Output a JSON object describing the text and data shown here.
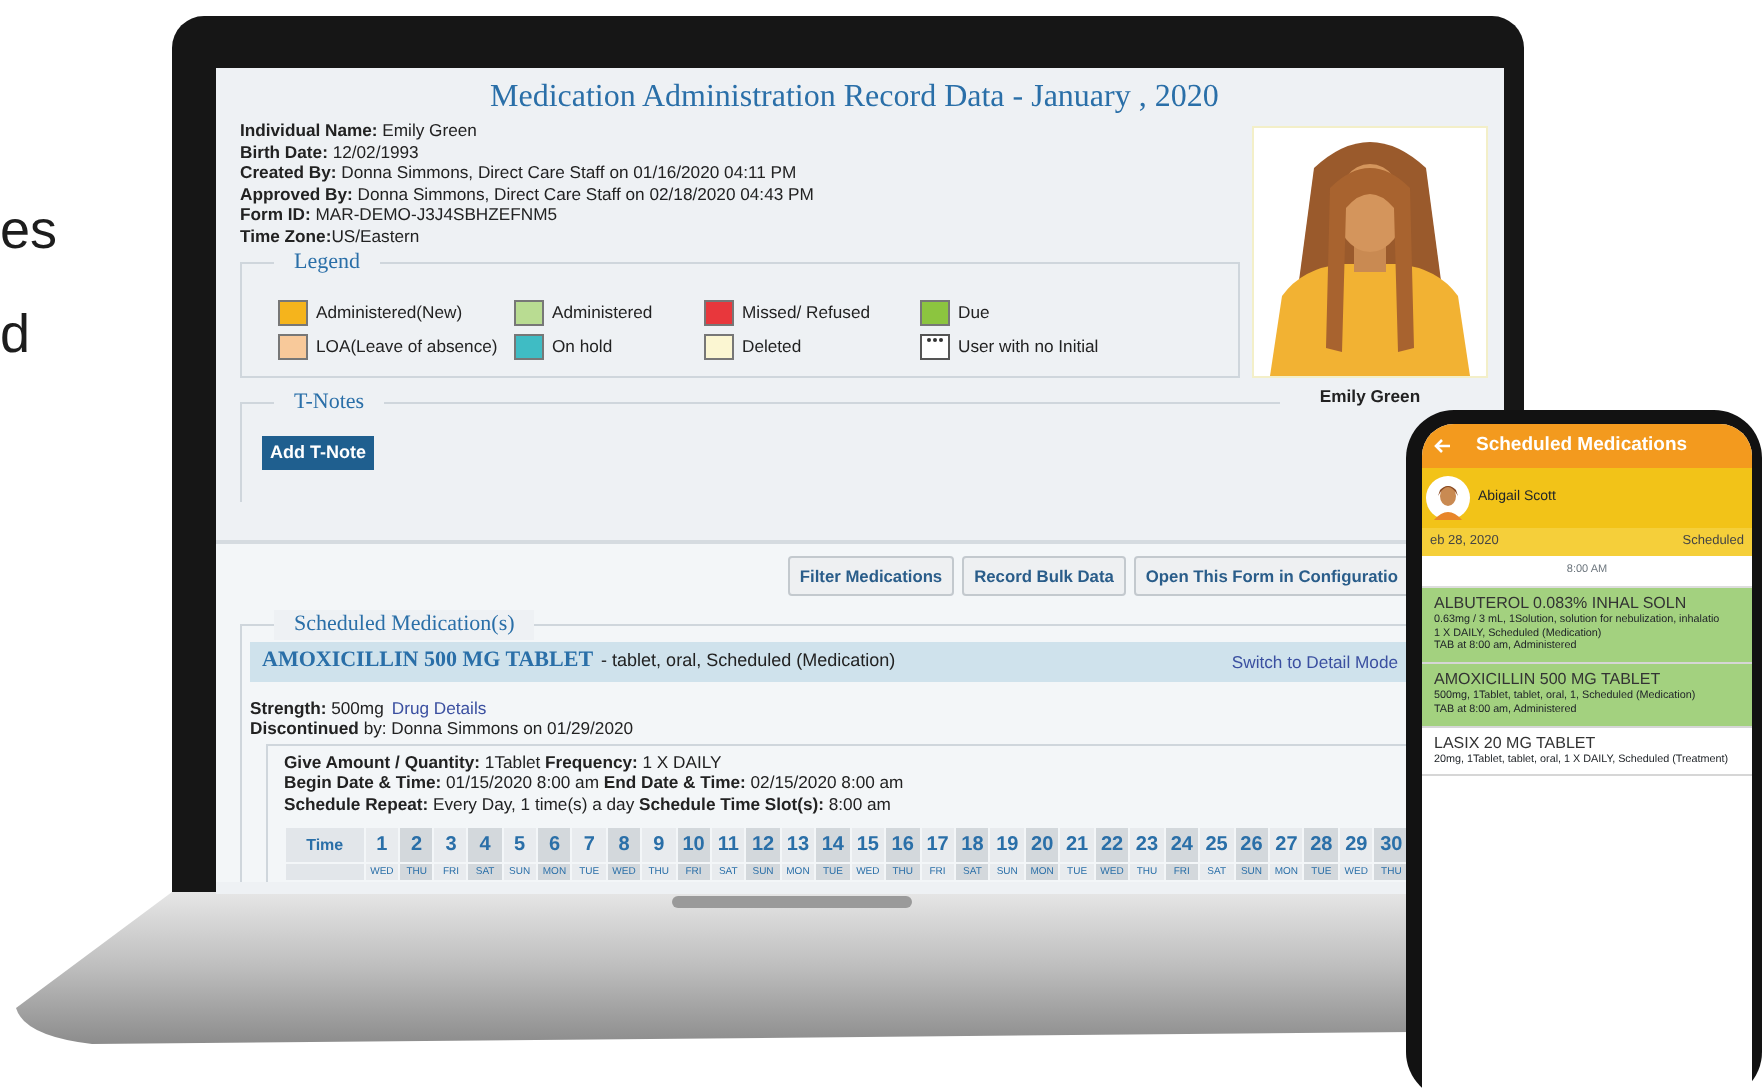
{
  "side_text": [
    "es",
    "d"
  ],
  "record": {
    "title": "Medication Administration Record Data - January , 2020",
    "info": [
      "**Individual Name:** Emily Green",
      "**Birth Date:** 12/02/1993",
      "**Created By:** Donna Simmons, Direct Care Staff on 01/16/2020 04:11 PM",
      "**Approved By:** Donna Simmons, Direct Care Staff on 02/18/2020 04:43 PM",
      "**Form ID:** MAR-DEMO-J3J4SBHZEFNM5",
      "**Time Zone:**US/Eastern"
    ],
    "photo_caption": "Emily Green",
    "legend": {
      "title": "Legend",
      "items": [
        {
          "label": "Administered(New)",
          "kind": "swatch",
          "color": "#f5b41c"
        },
        {
          "label": "Administered",
          "kind": "swatch",
          "color": "#b9dc92"
        },
        {
          "label": "Missed/ Refused",
          "kind": "swatch",
          "color": "#e8373c"
        },
        {
          "label": "Due",
          "kind": "swatch",
          "color": "#8cc53f"
        },
        {
          "label": "LOA(Leave of absence)",
          "kind": "swatch",
          "color": "#f8c99a"
        },
        {
          "label": "On hold",
          "kind": "swatch",
          "color": "#3fbcc4"
        },
        {
          "label": "Deleted",
          "kind": "swatch",
          "color": "#fbf6d2"
        },
        {
          "label": "User with no Initial",
          "kind": "dots"
        }
      ]
    },
    "tnotes": {
      "title": "T-Notes",
      "button": "Add T-Note"
    },
    "buttons": [
      "Filter Medications",
      "Record Bulk Data",
      "Open This Form in Configuratio"
    ],
    "section_title": "Scheduled Medication(s)",
    "medication": {
      "name": "AMOXICILLIN 500 MG TABLET",
      "description": "- tablet, oral, Scheduled (Medication)",
      "mode_link": "Switch to Detail Mode",
      "strength": "**Strength:** 500mg",
      "drug_link": "Drug Details",
      "discontinued": "**Discontinued** by: Donna Simmons on 01/29/2020",
      "details": [
        "**Give Amount / Quantity:** 1Tablet **Frequency:** 1 X DAILY",
        "**Begin Date & Time:** 01/15/2020 8:00 am **End Date & Time:** 02/15/2020 8:00 am",
        "**Schedule Repeat:** Every Day, 1 time(s) a day **Schedule Time Slot(s):** 8:00 am"
      ]
    },
    "schedule": {
      "time_label": "Time",
      "days": [
        {
          "day": "1",
          "weekday": "WED"
        },
        {
          "day": "2",
          "weekday": "THU"
        },
        {
          "day": "3",
          "weekday": "FRI"
        },
        {
          "day": "4",
          "weekday": "SAT"
        },
        {
          "day": "5",
          "weekday": "SUN"
        },
        {
          "day": "6",
          "weekday": "MON"
        },
        {
          "day": "7",
          "weekday": "TUE"
        },
        {
          "day": "8",
          "weekday": "WED"
        },
        {
          "day": "9",
          "weekday": "THU"
        },
        {
          "day": "10",
          "weekday": "FRI"
        },
        {
          "day": "11",
          "weekday": "SAT"
        },
        {
          "day": "12",
          "weekday": "SUN"
        },
        {
          "day": "13",
          "weekday": "MON"
        },
        {
          "day": "14",
          "weekday": "TUE"
        },
        {
          "day": "15",
          "weekday": "WED"
        },
        {
          "day": "16",
          "weekday": "THU"
        },
        {
          "day": "17",
          "weekday": "FRI"
        },
        {
          "day": "18",
          "weekday": "SAT"
        },
        {
          "day": "19",
          "weekday": "SUN"
        },
        {
          "day": "20",
          "weekday": "MON"
        },
        {
          "day": "21",
          "weekday": "TUE"
        },
        {
          "day": "22",
          "weekday": "WED"
        },
        {
          "day": "23",
          "weekday": "THU"
        },
        {
          "day": "24",
          "weekday": "FRI"
        },
        {
          "day": "25",
          "weekday": "SAT"
        },
        {
          "day": "26",
          "weekday": "SUN"
        },
        {
          "day": "27",
          "weekday": "MON"
        },
        {
          "day": "28",
          "weekday": "TUE"
        },
        {
          "day": "29",
          "weekday": "WED"
        },
        {
          "day": "30",
          "weekday": "THU"
        }
      ]
    }
  },
  "phone": {
    "title": "Scheduled Medications",
    "patient": "Abigail Scott",
    "date": "eb 28, 2020",
    "status": "Scheduled",
    "time": "8:00 AM",
    "items": [
      {
        "name": "ALBUTEROL 0.083% INHAL SOLN",
        "lines": [
          "0.63mg / 3 mL, 1Solution, solution for nebulization, inhalatio",
          "1 X DAILY, Scheduled (Medication)",
          "TAB at 8:00 am, Administered"
        ],
        "administered": true
      },
      {
        "name": "AMOXICILLIN 500 MG TABLET",
        "lines": [
          "500mg, 1Tablet, tablet, oral, 1, Scheduled (Medication)",
          "TAB at 8:00 am, Administered"
        ],
        "administered": true
      },
      {
        "name": "LASIX 20 MG TABLET",
        "lines": [
          "20mg, 1Tablet, tablet, oral, 1 X DAILY, Scheduled (Treatment)"
        ],
        "administered": false
      }
    ]
  }
}
